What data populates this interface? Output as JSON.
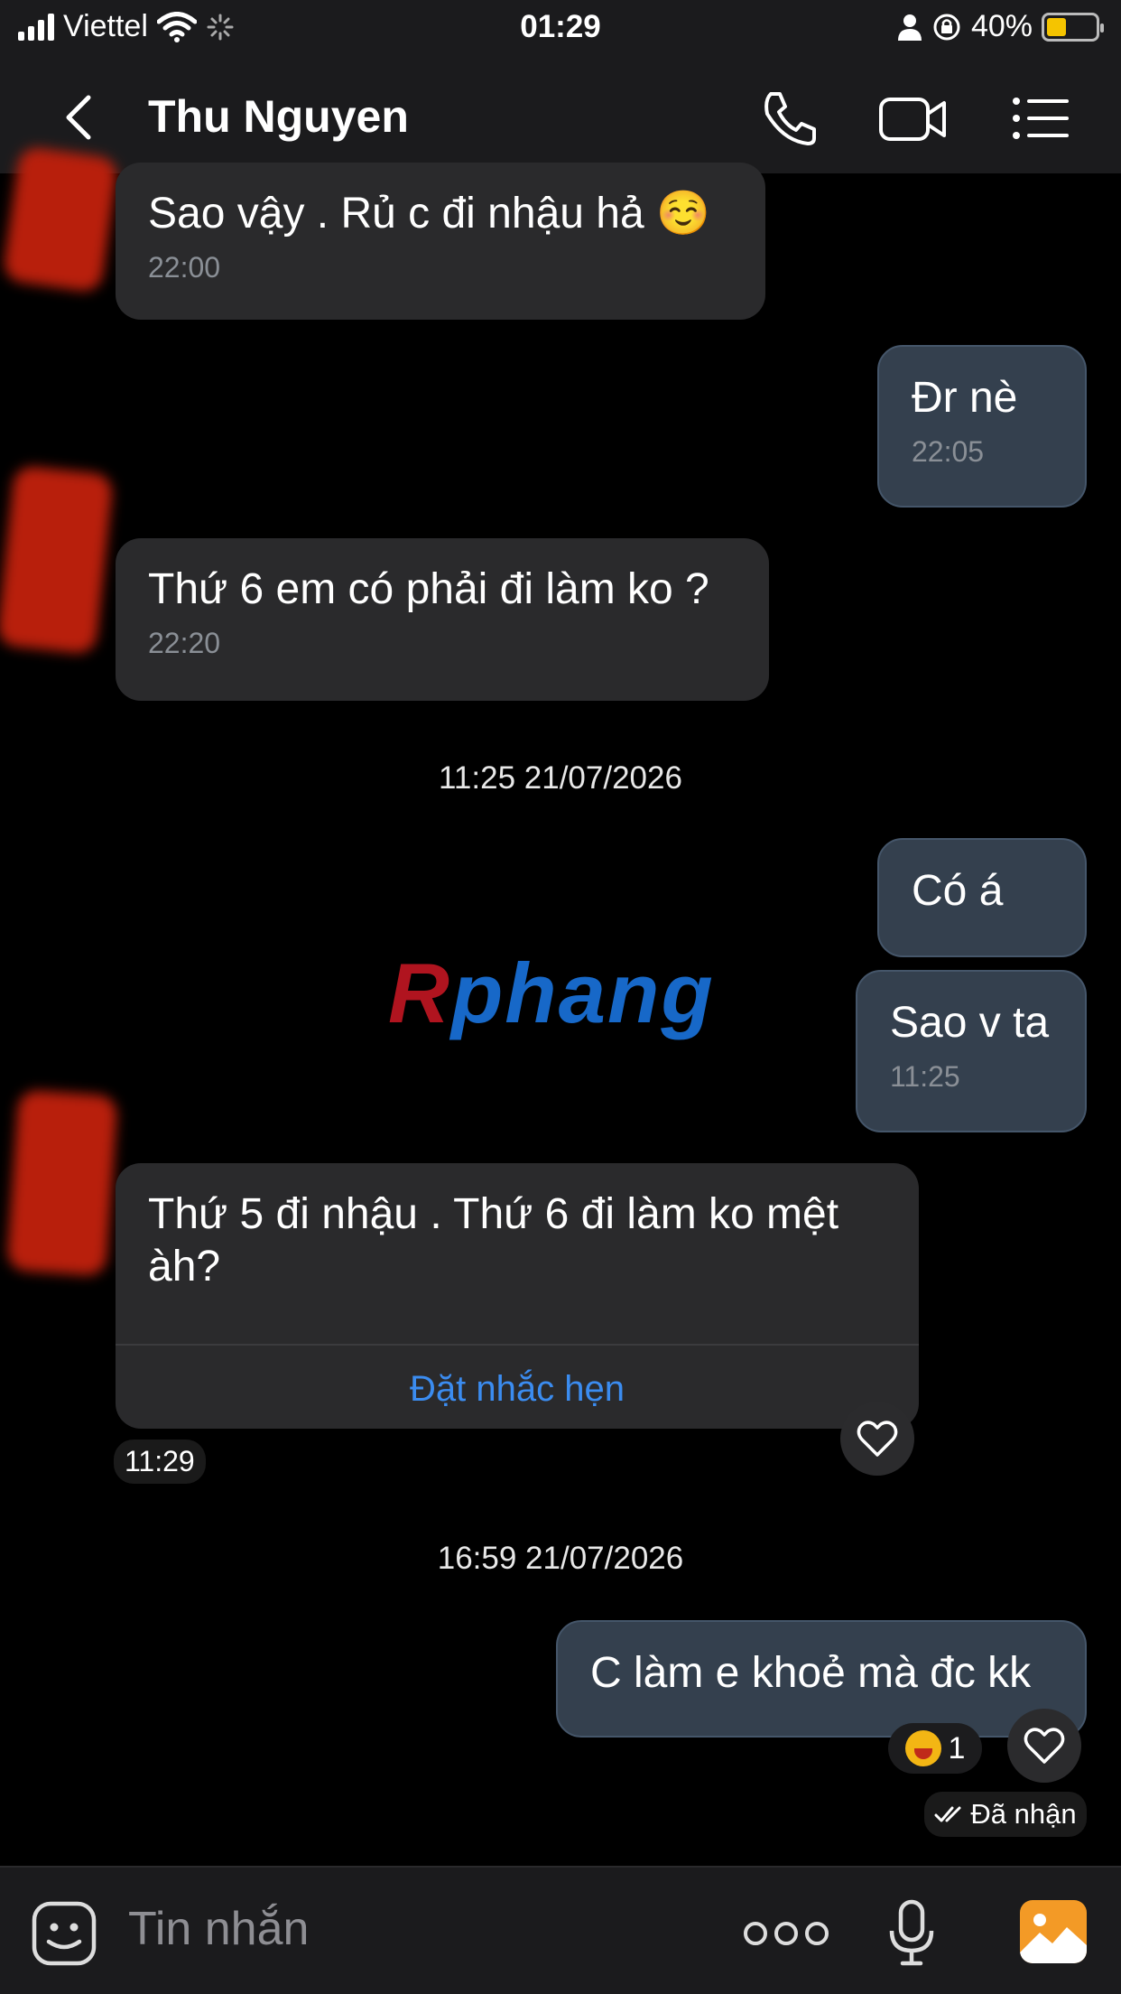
{
  "status_bar": {
    "carrier": "Viettel",
    "time": "01:29",
    "battery": "40%",
    "battery_level": 0.4
  },
  "header": {
    "contact_name": "Thu Nguyen"
  },
  "messages": [
    {
      "direction": "in",
      "text": "Sao vậy . Rủ c đi nhậu hả ☺️",
      "time": "22:00"
    },
    {
      "direction": "out",
      "text": "Đr nè",
      "time": "22:05"
    },
    {
      "direction": "in",
      "text": "Thứ 6 em có phải đi làm ko ?",
      "time": "22:20"
    },
    {
      "direction": "out",
      "text": "Có á",
      "time": ""
    },
    {
      "direction": "out",
      "text": "Sao v ta",
      "time": "11:25"
    },
    {
      "direction": "in",
      "text_line1": "Thứ 5 đi nhậu . Thứ 6 đi làm ko mệt",
      "text_line2": "àh?",
      "action": "Đặt nhắc hẹn",
      "time": "11:29"
    },
    {
      "direction": "out",
      "text": "C làm e khoẻ mà đc kk",
      "reaction_count": "1",
      "status": "Đã nhận"
    }
  ],
  "date_separators": [
    "11:25 21/07/2026",
    "16:59 21/07/2026"
  ],
  "watermark": {
    "first": "R",
    "rest": "phang"
  },
  "composer": {
    "placeholder": "Tin nhắn"
  },
  "colors": {
    "background": "#000000",
    "incoming_bubble": "#2a2a2c",
    "outgoing_bubble": "#34404e",
    "link": "#3b8cf0",
    "avatar_red": "#b81f0c"
  }
}
